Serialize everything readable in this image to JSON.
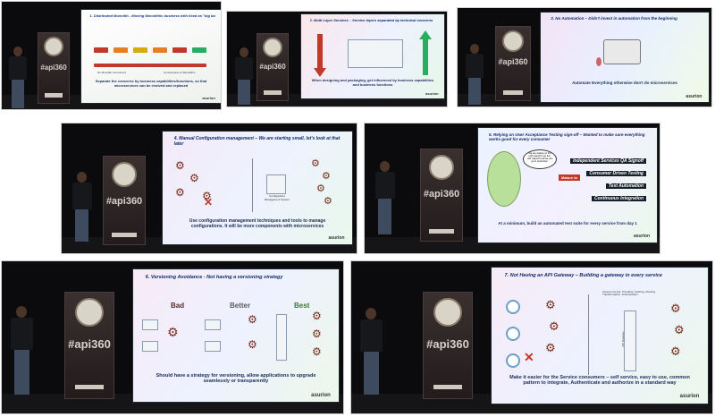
{
  "slides": {
    "s1": {
      "title": "1. Distributed Monolith - Moving Monolithic business with fixed as \"big ball of mud\"",
      "left_label": "No Monolith Consumers",
      "right_label": "Consumption of Monolithic",
      "caption": "Separate the concerns by business capabilities/functions, so that microservices can be evolved and replaced"
    },
    "s2": {
      "title": "2. Multi Layer Services – Service layers separated by technical concerns",
      "caption": "When designing and packaging, get influenced by business capabilities and business functions"
    },
    "s3": {
      "title": "3. No Automation – Didn't invest in automation from the beginning",
      "caption": "Automate Everything otherwise don't do microservices"
    },
    "s4": {
      "title": "4. Manual Configuration management – We are starting small, let's look at that later",
      "center_label": "Configuration Management System",
      "caption": "Use configuration management techniques and tools to manage configurations. It will be more components with microservices"
    },
    "s5": {
      "title": "5. Relying on User Acceptance Testing sign-off – Wanted to make sure everything works good for every consumer",
      "bubble": "We are waiting on the UAT signoff to go live. UAT Signoff is all we can go to production.",
      "arrow_label": "Mature to",
      "list": [
        "Independent Services QA Signoff",
        "Consumer Driven Testing",
        "Test Automation",
        "Continuous Integration"
      ],
      "caption": "At a minimum, build an automated test suite for every service from day 1"
    },
    "s6": {
      "title": "6. Versioning Avoidance - Not having a versioning strategy",
      "labels": [
        "Bad",
        "Better",
        "Best"
      ],
      "caption": "Should have a strategy for versioning, allow applications to upgrade seamlessly or transparently"
    },
    "s7": {
      "title": "7. Not Having an API Gateway – Building a gateway in every service",
      "gateway_note": "Access Control, Throttling, Caching, Routing, Transformation, Orchestration",
      "gateway_label": "API Gateway",
      "caption": "Make it easier for the Service consumers – self service, easy to use, common pattern to integrate, Authenticate and authorize in a standard way"
    }
  },
  "event": {
    "hashtag": "#api360",
    "powered_by": "Powered by",
    "brand": "asurion"
  },
  "colors": {
    "stage_dark": "#0b0b0e",
    "slide_title": "#0e2a6a",
    "gear_red": "#7a2a1a"
  }
}
